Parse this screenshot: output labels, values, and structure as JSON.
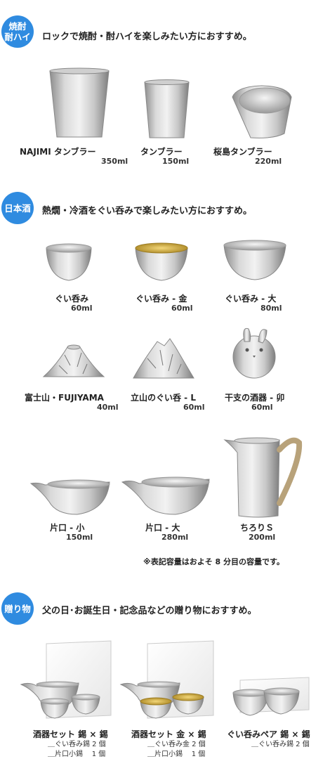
{
  "sections": [
    {
      "badge": "焼酎\n耐ハイ",
      "title": "ロックで焼酎・酎ハイを楽しみたい方におすすめ。"
    },
    {
      "badge": "日本酒",
      "title": "熱燗・冷酒をぐい呑みで楽しみたい方におすすめ。"
    },
    {
      "badge": "贈り物",
      "title": "父の日･お誕生日・記念品などの贈り物におすすめ。"
    }
  ],
  "products": [
    {
      "name": "NAJIMI タンブラー",
      "volume": "350ml"
    },
    {
      "name": "タンブラー",
      "volume": "150ml"
    },
    {
      "name": "桜島タンブラー",
      "volume": "220ml"
    },
    {
      "name": "ぐい呑み",
      "volume": "60ml"
    },
    {
      "name": "ぐい呑み - 金",
      "volume": "60ml"
    },
    {
      "name": "ぐい呑み - 大",
      "volume": "80ml"
    },
    {
      "name": "富士山・FUJIYAMA",
      "volume": "40ml"
    },
    {
      "name": "立山のぐい呑 - L",
      "volume": "60ml"
    },
    {
      "name": "干支の酒器 - 卯",
      "volume": "60ml"
    },
    {
      "name": "片口 - 小",
      "volume": "150ml"
    },
    {
      "name": "片口 - 大",
      "volume": "280ml"
    },
    {
      "name": "ちろりＳ",
      "volume": "200ml"
    }
  ],
  "note": "※表記容量はおよそ 8 分目の容量です。",
  "gifts": [
    {
      "name": "酒器セット 錫 × 錫",
      "lines": "＿ぐい呑み錫 2 個\n＿片口小錫    1 個"
    },
    {
      "name": "酒器セット 金 × 錫",
      "lines": "＿ぐい呑み金 2 個\n＿片口小錫    1 個"
    },
    {
      "name": "ぐい呑みペア 錫 × 錫",
      "lines": "＿ぐい呑み錫 2 個"
    }
  ]
}
